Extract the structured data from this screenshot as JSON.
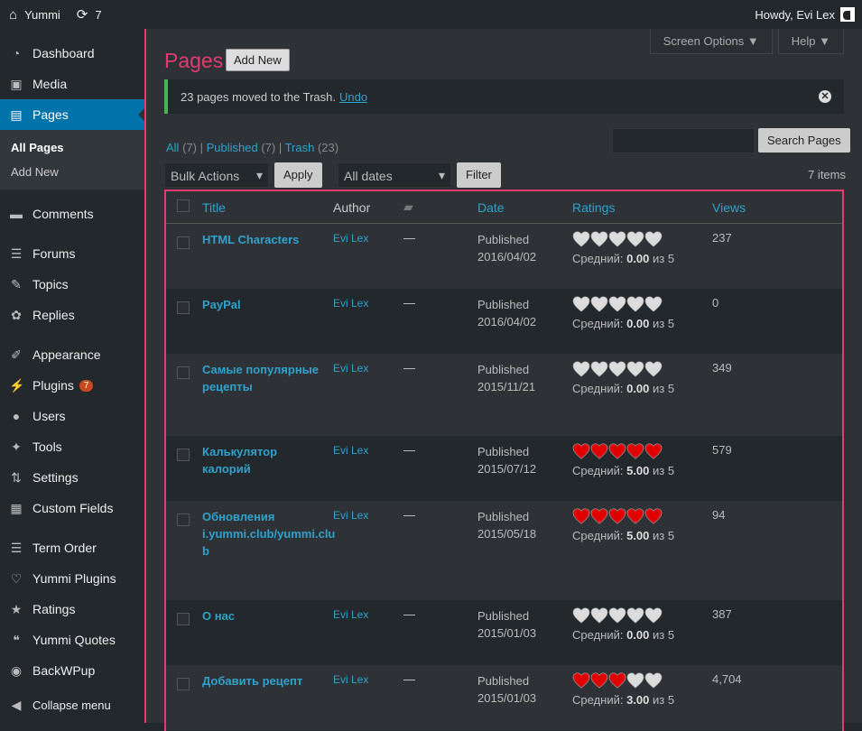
{
  "topbar": {
    "site": "Yummi",
    "updates": "7",
    "howdy": "Howdy, Evi Lex"
  },
  "sidebar": {
    "items": [
      {
        "label": "Dashboard",
        "icon": "dashboard-icon",
        "glyph": "◔"
      },
      {
        "label": "Media",
        "icon": "media-icon",
        "glyph": "▣"
      },
      {
        "label": "Pages",
        "icon": "pages-icon",
        "glyph": "▤"
      },
      {
        "label": "Comments",
        "icon": "comments-icon",
        "glyph": "▬"
      },
      {
        "label": "Forums",
        "icon": "forums-icon",
        "glyph": "☰"
      },
      {
        "label": "Topics",
        "icon": "topics-icon",
        "glyph": "✎"
      },
      {
        "label": "Replies",
        "icon": "replies-icon",
        "glyph": "✿"
      },
      {
        "label": "Appearance",
        "icon": "appearance-icon",
        "glyph": "✐"
      },
      {
        "label": "Plugins",
        "icon": "plugins-icon",
        "glyph": "⚡",
        "badge": "7"
      },
      {
        "label": "Users",
        "icon": "users-icon",
        "glyph": "●"
      },
      {
        "label": "Tools",
        "icon": "tools-icon",
        "glyph": "✦"
      },
      {
        "label": "Settings",
        "icon": "settings-icon",
        "glyph": "⇅"
      },
      {
        "label": "Custom Fields",
        "icon": "custom-fields-icon",
        "glyph": "▦"
      },
      {
        "label": "Term Order",
        "icon": "term-order-icon",
        "glyph": "☰"
      },
      {
        "label": "Yummi Plugins",
        "icon": "yummi-plugins-icon",
        "glyph": "♡"
      },
      {
        "label": "Ratings",
        "icon": "ratings-icon",
        "glyph": "★"
      },
      {
        "label": "Yummi Quotes",
        "icon": "quotes-icon",
        "glyph": "❝"
      },
      {
        "label": "BackWPup",
        "icon": "backwpup-icon",
        "glyph": "◉"
      },
      {
        "label": "Collapse menu",
        "icon": "collapse-icon",
        "glyph": "◀"
      }
    ],
    "sub": {
      "all": "All Pages",
      "add": "Add New"
    }
  },
  "screen_options": "Screen Options ▼",
  "help": "Help ▼",
  "page_title": "Pages",
  "add_new": "Add New",
  "notice": {
    "text": "23 pages moved to the Trash.",
    "undo": "Undo"
  },
  "views": {
    "all": "All",
    "all_count": "(7)",
    "published": "Published",
    "published_count": "(7)",
    "trash": "Trash",
    "trash_count": "(23)"
  },
  "search_button": "Search Pages",
  "bulk_actions": "Bulk Actions",
  "apply": "Apply",
  "dates": "All dates",
  "filter": "Filter",
  "items_count": "7 items",
  "columns": {
    "title": "Title",
    "author": "Author",
    "date": "Date",
    "ratings": "Ratings",
    "views": "Views"
  },
  "colors": {
    "accent": "#e43b6e",
    "link": "#2ea2cc",
    "heart_red": "#e00000",
    "heart_empty": "#dcdcdc"
  },
  "rows": [
    {
      "title": "HTML Characters",
      "author": "Evi Lex",
      "comments": "—",
      "status": "Published",
      "date": "2016/04/02",
      "rating": 0,
      "avg_label": "Средний:",
      "avg": "0.00",
      "of": "из 5",
      "views": "237"
    },
    {
      "title": "PayPal",
      "author": "Evi Lex",
      "comments": "—",
      "status": "Published",
      "date": "2016/04/02",
      "rating": 0,
      "avg_label": "Средний:",
      "avg": "0.00",
      "of": "из 5",
      "views": "0"
    },
    {
      "title": "Самые популярные рецепты",
      "author": "Evi Lex",
      "comments": "—",
      "status": "Published",
      "date": "2015/11/21",
      "rating": 0,
      "avg_label": "Средний:",
      "avg": "0.00",
      "of": "из 5",
      "views": "349"
    },
    {
      "title": "Калькулятор калорий",
      "author": "Evi Lex",
      "comments": "—",
      "status": "Published",
      "date": "2015/07/12",
      "rating": 5,
      "avg_label": "Средний:",
      "avg": "5.00",
      "of": "из 5",
      "views": "579"
    },
    {
      "title": "Обновления i.yummi.club/yummi.clu b",
      "author": "Evi Lex",
      "comments": "—",
      "status": "Published",
      "date": "2015/05/18",
      "rating": 5,
      "avg_label": "Средний:",
      "avg": "5.00",
      "of": "из 5",
      "views": "94"
    },
    {
      "title": "О нас",
      "author": "Evi Lex",
      "comments": "—",
      "status": "Published",
      "date": "2015/01/03",
      "rating": 0,
      "avg_label": "Средний:",
      "avg": "0.00",
      "of": "из 5",
      "views": "387"
    },
    {
      "title": "Добавить рецепт",
      "author": "Evi Lex",
      "comments": "—",
      "status": "Published",
      "date": "2015/01/03",
      "rating": 3,
      "avg_label": "Средний:",
      "avg": "3.00",
      "of": "из 5",
      "views": "4,704"
    }
  ]
}
